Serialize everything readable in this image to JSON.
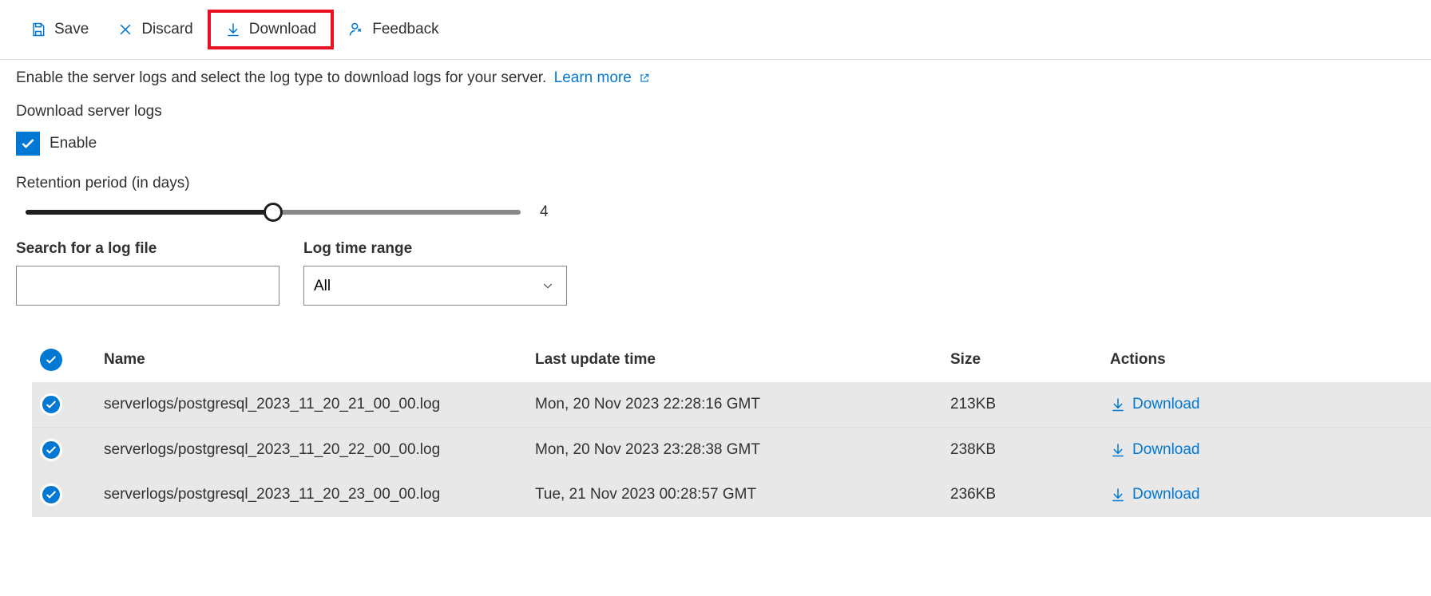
{
  "toolbar": {
    "save": "Save",
    "discard": "Discard",
    "download": "Download",
    "feedback": "Feedback"
  },
  "description": "Enable the server logs and select the log type to download logs for your server.",
  "learn_more": "Learn more",
  "download_logs_label": "Download server logs",
  "enable_label": "Enable",
  "retention_label": "Retention period (in days)",
  "retention_value": "4",
  "search_label": "Search for a log file",
  "time_range_label": "Log time range",
  "time_range_value": "All",
  "columns": {
    "name": "Name",
    "last_update": "Last update time",
    "size": "Size",
    "actions": "Actions"
  },
  "action_download": "Download",
  "rows": [
    {
      "name": "serverlogs/postgresql_2023_11_20_21_00_00.log",
      "updated": "Mon, 20 Nov 2023 22:28:16 GMT",
      "size": "213KB"
    },
    {
      "name": "serverlogs/postgresql_2023_11_20_22_00_00.log",
      "updated": "Mon, 20 Nov 2023 23:28:38 GMT",
      "size": "238KB"
    },
    {
      "name": "serverlogs/postgresql_2023_11_20_23_00_00.log",
      "updated": "Tue, 21 Nov 2023 00:28:57 GMT",
      "size": "236KB"
    }
  ]
}
